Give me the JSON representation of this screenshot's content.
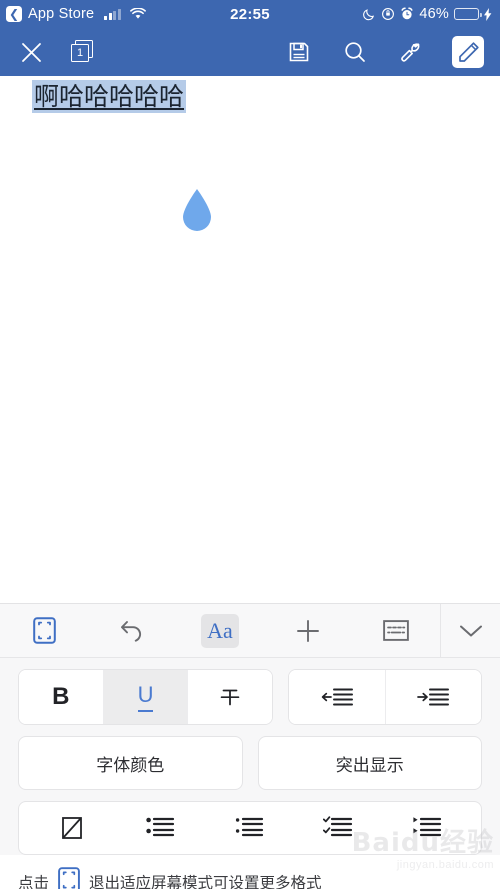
{
  "status_bar": {
    "back_label": "App Store",
    "back_icon": "chevron-left-icon",
    "signal_icon": "cellular-signal-icon",
    "wifi_icon": "wifi-icon",
    "time": "22:55",
    "moon_icon": "do-not-disturb-moon-icon",
    "rotation_lock_icon": "rotation-lock-icon",
    "alarm_icon": "alarm-clock-icon",
    "battery_percent": "46%",
    "battery_icon": "battery-low-power-icon",
    "charging_icon": "lightning-bolt-icon",
    "bar_color": "#3d67b0",
    "battery_fill_color": "#f5c344"
  },
  "app_header": {
    "close_label": "close-icon",
    "page_count": "1",
    "pages_icon": "pages-stack-icon",
    "save_icon": "save-floppy-icon",
    "search_icon": "search-icon",
    "tools_icon": "wrench-icon",
    "edit_icon": "pencil-edit-icon",
    "edit_active": "true",
    "bar_color": "#3d67b0"
  },
  "document": {
    "text": "啊哈哈哈哈哈",
    "selection_color": "#b5cbe8",
    "handle_color": "#6fa8eb",
    "handle_icon": "selection-handle-teardrop-icon",
    "underlined": "true"
  },
  "format_panel": {
    "tabs": [
      {
        "name": "adapt-screen",
        "icon": "fit-to-screen-icon",
        "selected": "false",
        "accent": "#3f6fc4"
      },
      {
        "name": "undo",
        "icon": "undo-arrow-icon",
        "selected": "false"
      },
      {
        "name": "font-format",
        "icon": "Aa",
        "selected": "true"
      },
      {
        "name": "insert",
        "icon": "plus-icon",
        "selected": "false"
      },
      {
        "name": "keyboard",
        "icon": "keyboard-icon",
        "selected": "false"
      },
      {
        "name": "collapse",
        "icon": "chevron-down-icon",
        "selected": "false"
      }
    ],
    "text_style": [
      {
        "name": "bold",
        "label": "B",
        "active": "false"
      },
      {
        "name": "underline",
        "label": "U",
        "active": "true"
      },
      {
        "name": "strikethrough",
        "label": "T",
        "active": "false"
      }
    ],
    "indent": [
      {
        "name": "decrease-indent",
        "icon": "outdent-icon"
      },
      {
        "name": "increase-indent",
        "icon": "indent-icon"
      }
    ],
    "color_buttons": [
      {
        "name": "font-color",
        "label": "字体颜色"
      },
      {
        "name": "highlight",
        "label": "突出显示"
      }
    ],
    "list_styles": [
      {
        "name": "no-list",
        "icon": "none-slash-icon"
      },
      {
        "name": "bullet-list-round",
        "icon": "bullet-list-icon"
      },
      {
        "name": "bullet-list-small",
        "icon": "bullet-list-small-icon"
      },
      {
        "name": "check-list",
        "icon": "checkmark-list-icon"
      },
      {
        "name": "arrow-list",
        "icon": "arrow-list-icon"
      }
    ],
    "active_color": "#4a7ad0"
  },
  "hint": {
    "prefix": "点击",
    "icon": "fit-to-screen-icon",
    "middle": "退出",
    "accent": "适应屏幕模式",
    "suffix": "可设置更多格式"
  },
  "watermark": {
    "main": "Baidu经验",
    "sub": "jingyan.baidu.com"
  }
}
